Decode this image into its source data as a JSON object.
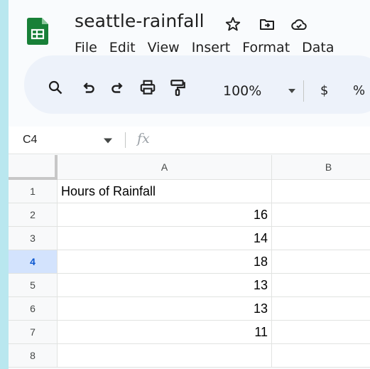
{
  "document": {
    "title": "seattle-rainfall"
  },
  "menu": [
    "File",
    "Edit",
    "View",
    "Insert",
    "Format",
    "Data"
  ],
  "toolbar": {
    "zoom": "100%",
    "currency_label": "$",
    "percent_label": "%"
  },
  "formula_bar": {
    "name_box": "C4",
    "fx_label": "fx",
    "value": ""
  },
  "sheet": {
    "columns": [
      "A",
      "B"
    ],
    "rows": [
      {
        "num": "1",
        "a": "Hours of Rainfall",
        "b": ""
      },
      {
        "num": "2",
        "a": "16",
        "b": ""
      },
      {
        "num": "3",
        "a": "14",
        "b": ""
      },
      {
        "num": "4",
        "a": "18",
        "b": ""
      },
      {
        "num": "5",
        "a": "13",
        "b": ""
      },
      {
        "num": "6",
        "a": "13",
        "b": ""
      },
      {
        "num": "7",
        "a": "11",
        "b": ""
      },
      {
        "num": "8",
        "a": "",
        "b": ""
      }
    ],
    "active_row": "4"
  },
  "colors": {
    "logo_green": "#188038",
    "active_row_bg": "#d3e3fd",
    "active_row_text": "#0b57d0",
    "toolbar_bg": "#edf2fa",
    "outer_bg": "#b9e7ef"
  }
}
